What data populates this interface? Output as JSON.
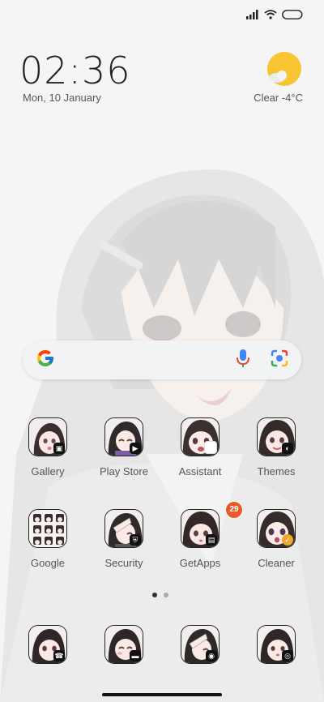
{
  "clock": {
    "time": "02:36",
    "date": "Mon, 10 January"
  },
  "weather": {
    "text": "Clear  -4°C",
    "icon": "sun-cloud-icon",
    "sun_color": "#f7c531"
  },
  "status": {
    "icons": [
      "signal-icon",
      "wifi-icon",
      "battery-icon"
    ]
  },
  "search": {
    "logo": "google-g-icon",
    "mic": "mic-icon",
    "lens": "lens-icon"
  },
  "apps": {
    "row1": [
      {
        "label": "Gallery",
        "mini": "▣"
      },
      {
        "label": "Play Store",
        "mini": "▶"
      },
      {
        "label": "Assistant",
        "mini": ""
      },
      {
        "label": "Themes",
        "mini": "◐"
      }
    ],
    "row2": [
      {
        "label": "Google",
        "mini": ""
      },
      {
        "label": "Security",
        "mini": "⛨"
      },
      {
        "label": "GetApps",
        "mini": "▤",
        "badge": "29"
      },
      {
        "label": "Cleaner",
        "mini": "✓"
      }
    ],
    "dock": [
      {
        "label": "",
        "mini": "☎"
      },
      {
        "label": "",
        "mini": "▬"
      },
      {
        "label": "",
        "mini": "◉"
      },
      {
        "label": "",
        "mini": "◎"
      }
    ]
  },
  "page_indicator": {
    "count": 2,
    "active": 0
  },
  "colors": {
    "accent_badge": "#e85b29",
    "text": "#555555"
  }
}
